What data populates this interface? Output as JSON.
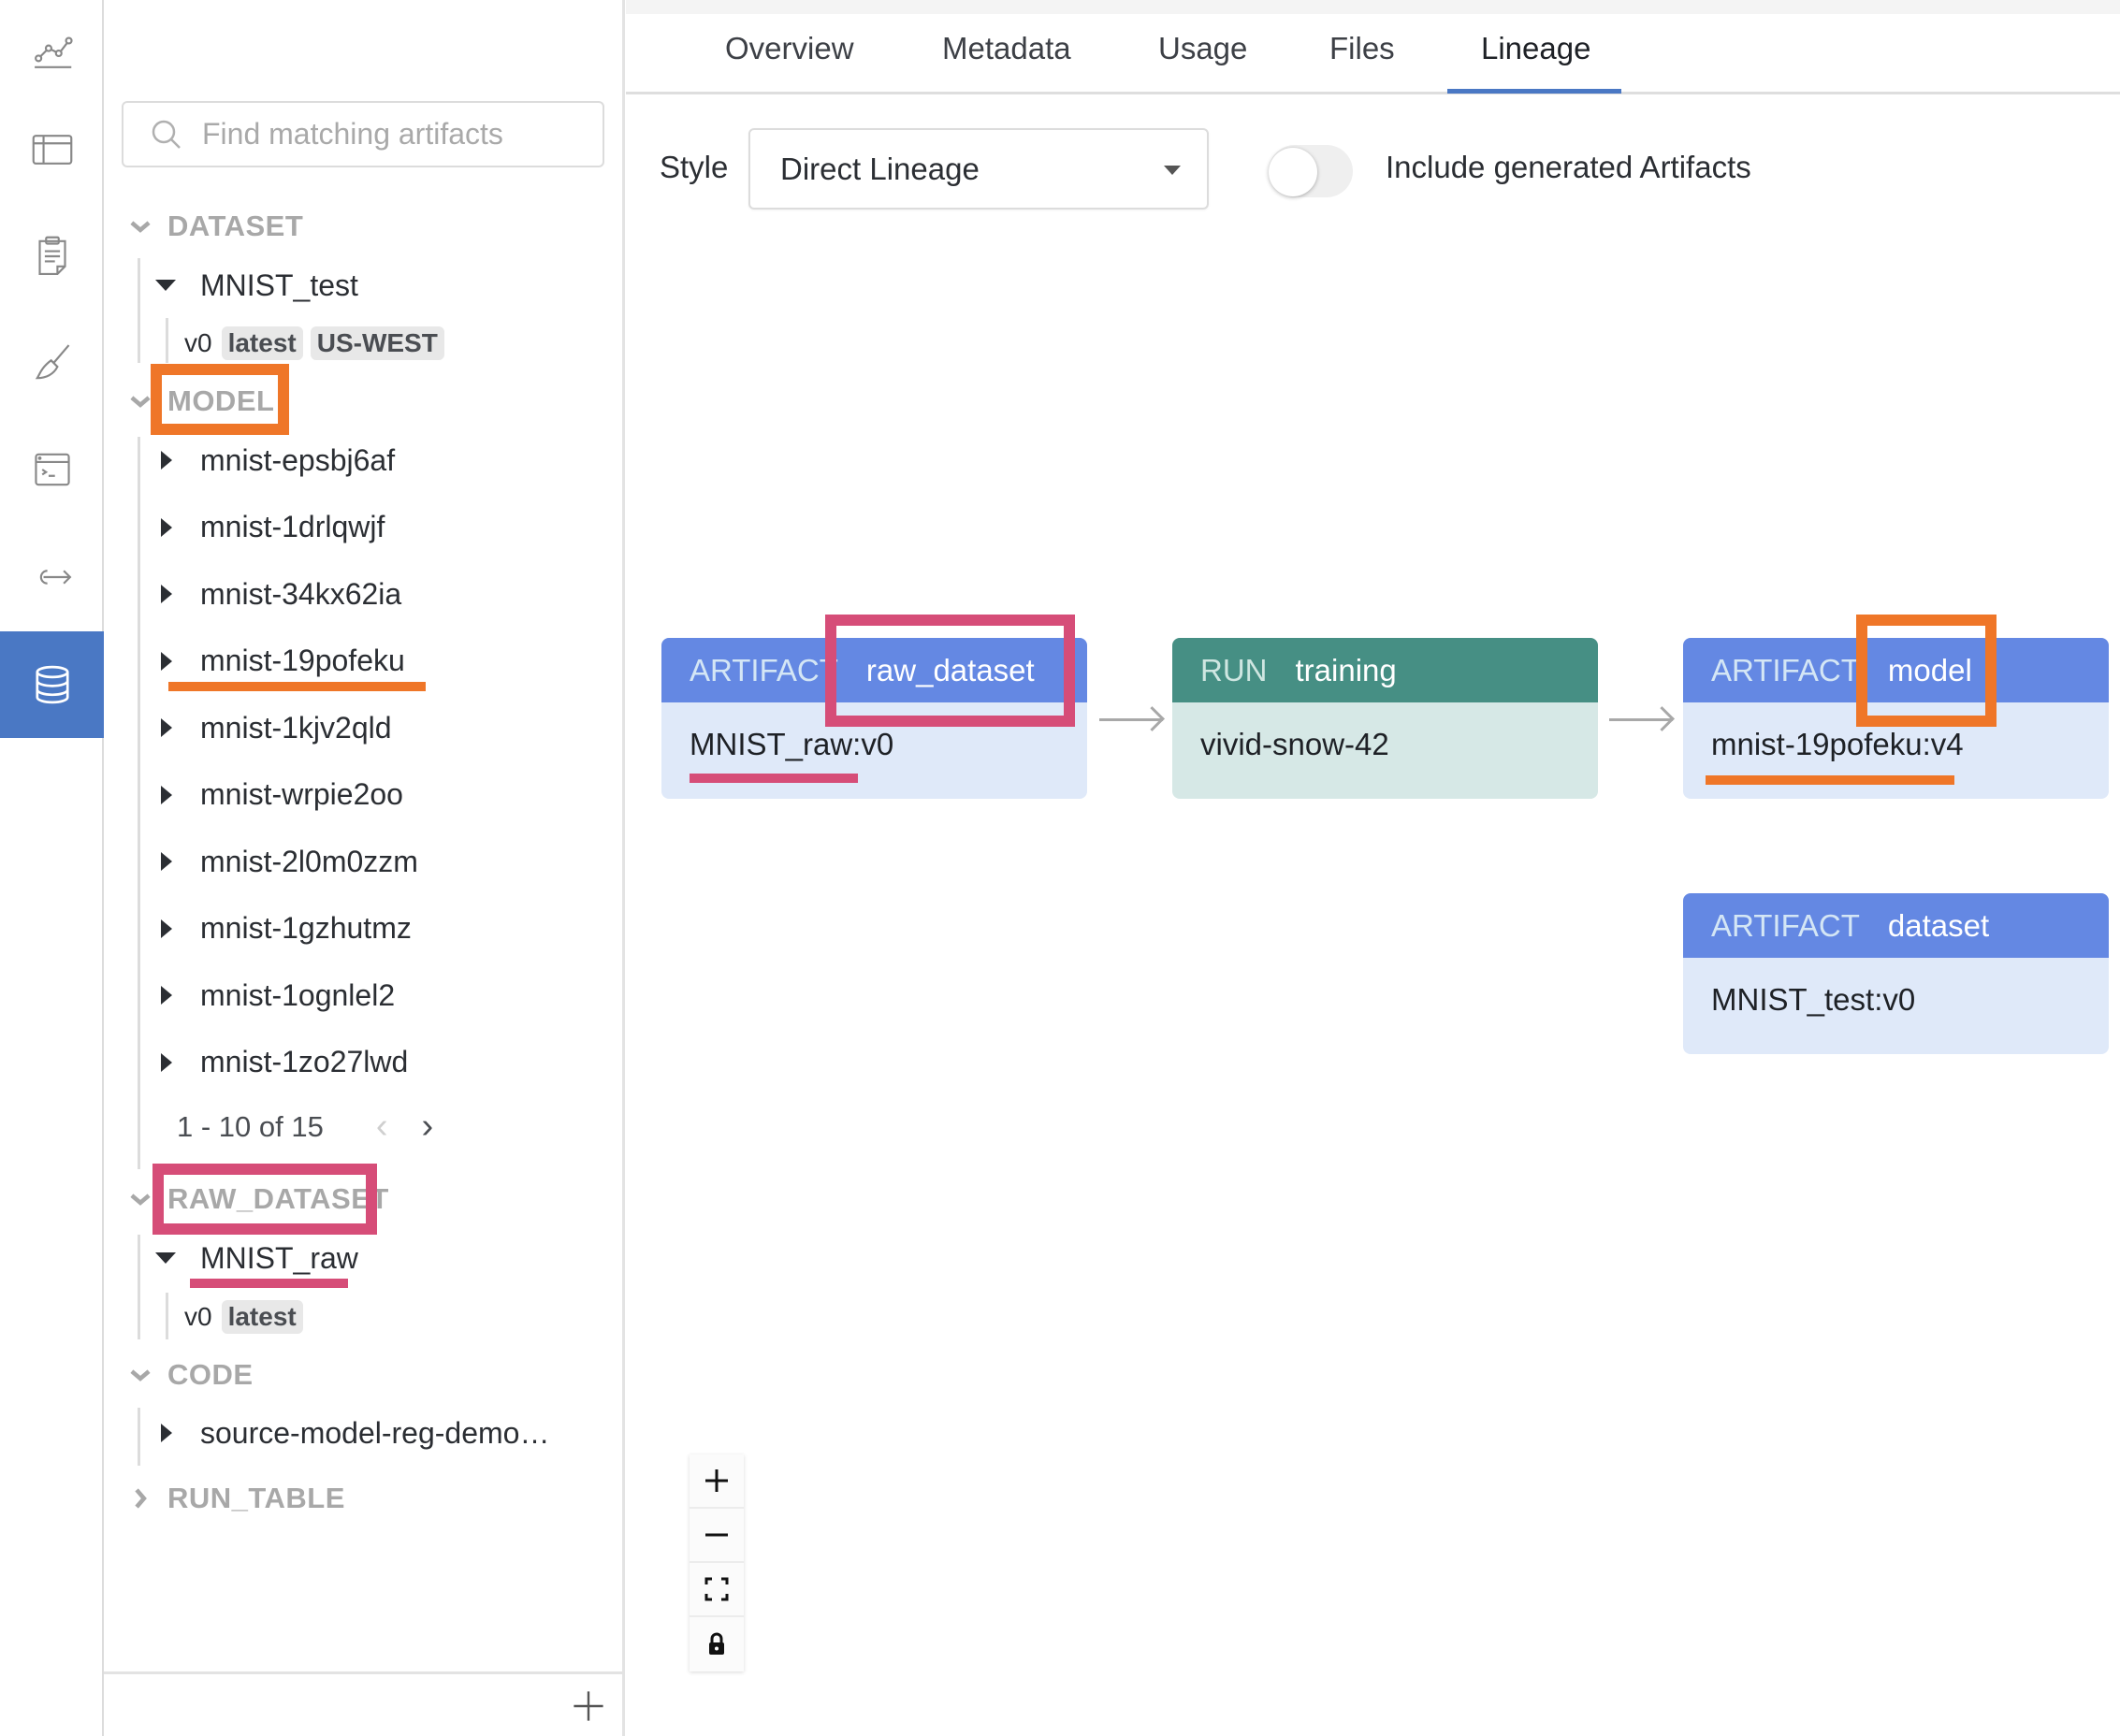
{
  "rail": {
    "items": [
      {
        "icon": "line-chart-icon",
        "active": false
      },
      {
        "icon": "table-icon",
        "active": false
      },
      {
        "icon": "clipboard-report-icon",
        "active": false
      },
      {
        "icon": "sweep-broom-icon",
        "active": false
      },
      {
        "icon": "terminal-window-icon",
        "active": false
      },
      {
        "icon": "export-arrow-icon",
        "active": false
      },
      {
        "icon": "database-icon",
        "active": true
      }
    ]
  },
  "sidebar": {
    "search_placeholder": "Find matching artifacts",
    "sections": [
      {
        "label": "DATASET",
        "expanded": true,
        "artifacts": [
          {
            "name": "MNIST_test",
            "expanded": true,
            "version": "v0",
            "tags": [
              "latest",
              "US-WEST"
            ]
          }
        ]
      },
      {
        "label": "MODEL",
        "expanded": true,
        "artifacts": [
          {
            "name": "mnist-epsbj6af"
          },
          {
            "name": "mnist-1drlqwjf"
          },
          {
            "name": "mnist-34kx62ia"
          },
          {
            "name": "mnist-19pofeku"
          },
          {
            "name": "mnist-1kjv2qld"
          },
          {
            "name": "mnist-wrpie2oo"
          },
          {
            "name": "mnist-2l0m0zzm"
          },
          {
            "name": "mnist-1gzhutmz"
          },
          {
            "name": "mnist-1ognlel2"
          },
          {
            "name": "mnist-1zo27lwd"
          }
        ],
        "pagination": "1 - 10 of 15"
      },
      {
        "label": "RAW_DATASET",
        "expanded": true,
        "artifacts": [
          {
            "name": "MNIST_raw",
            "expanded": true,
            "version": "v0",
            "tags": [
              "latest"
            ]
          }
        ]
      },
      {
        "label": "CODE",
        "expanded": true,
        "artifacts": [
          {
            "name": "source-model-reg-demo…"
          }
        ]
      },
      {
        "label": "RUN_TABLE",
        "expanded": false,
        "artifacts": []
      }
    ]
  },
  "tabs": [
    {
      "label": "Overview",
      "active": false
    },
    {
      "label": "Metadata",
      "active": false
    },
    {
      "label": "Usage",
      "active": false
    },
    {
      "label": "Files",
      "active": false
    },
    {
      "label": "Lineage",
      "active": true
    }
  ],
  "controls": {
    "style_label": "Style",
    "style_value": "Direct Lineage",
    "toggle_label": "Include generated Artifacts",
    "toggle_on": false
  },
  "lineage": {
    "nodes": [
      {
        "kind": "ARTIFACT",
        "type": "raw_dataset",
        "name": "MNIST_raw:v0"
      },
      {
        "kind": "RUN",
        "type": "training",
        "name": "vivid-snow-42"
      },
      {
        "kind": "ARTIFACT",
        "type": "model",
        "name": "mnist-19pofeku:v4"
      },
      {
        "kind": "ARTIFACT",
        "type": "dataset",
        "name": "MNIST_test:v0"
      }
    ]
  },
  "colors": {
    "accent": "#4a78c4",
    "artifact_header": "#6488e3",
    "artifact_body": "#dfe9f9",
    "run_header": "#468f84",
    "run_body": "#d6e8e6",
    "highlight_orange": "#ef7628",
    "highlight_pink": "#d64d78"
  }
}
